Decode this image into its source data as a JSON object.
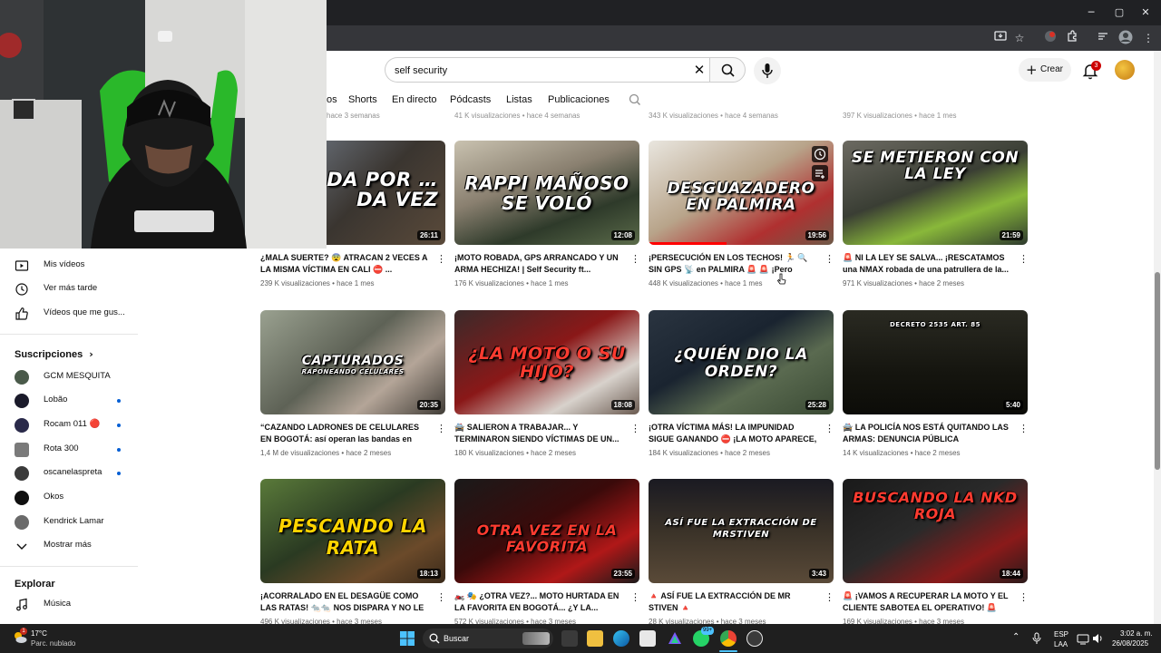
{
  "browser": {
    "window_controls": {
      "minimize": "─",
      "maximize": "▢",
      "close": "✕"
    }
  },
  "masthead": {
    "search_value": "self security",
    "create_label": "Crear",
    "notification_count": "3"
  },
  "chips": [
    "os",
    "Shorts",
    "En directo",
    "Pódcasts",
    "Listas",
    "Publicaciones"
  ],
  "sidebar": {
    "items": [
      {
        "label": "Mis vídeos",
        "icon": "play-square-icon"
      },
      {
        "label": "Ver más tarde",
        "icon": "clock-icon"
      },
      {
        "label": "Vídeos que me gus...",
        "icon": "thumbs-up-icon"
      }
    ],
    "subscriptions_heading": "Suscripciones",
    "subscriptions": [
      {
        "label": "GCM MESQUITA",
        "dot": false
      },
      {
        "label": "Lobão",
        "dot": true
      },
      {
        "label": "Rocam 011 🔴",
        "dot": true
      },
      {
        "label": "Rota 300",
        "dot": true
      },
      {
        "label": "oscanelaspreta",
        "dot": true
      },
      {
        "label": "Okos",
        "dot": false
      },
      {
        "label": "Kendrick Lamar",
        "dot": false
      }
    ],
    "show_more": "Mostrar más",
    "explore_heading": "Explorar",
    "explore_items": [
      {
        "label": "Música"
      }
    ]
  },
  "top_meta": [
    "hace 3 semanas",
    "41 K visualizaciones • hace 4 semanas",
    "343 K visualizaciones • hace 4 semanas",
    "397 K visualizaciones • hace 1 mes"
  ],
  "videos": [
    {
      "thumb_text": "…ADA POR …DA VEZ",
      "duration": "26:11",
      "title": "¿MALA SUERTE? 😨 ATRACAN 2 VECES A LA MISMA VÍCTIMA EN CALI ⛔ ...",
      "meta": "239 K visualizaciones • hace 1 mes"
    },
    {
      "thumb_text": "RAPPI MAÑOSO SE VOLÓ",
      "duration": "12:08",
      "title": "¡MOTO ROBADA, GPS ARRANCADO Y UN ARMA HECHIZA! | Self Security ft...",
      "meta": "176 K visualizaciones • hace 1 mes"
    },
    {
      "thumb_text": "DESGUAZADERO EN PALMIRA",
      "duration": "19:56",
      "title": "¡PERSECUCIÓN EN LOS TECHOS! 🏃 🔍 SIN GPS 📡 en PALMIRA 🚨 🚨 ¡Pero IGUAL la...",
      "meta": "448 K visualizaciones • hace 1 mes"
    },
    {
      "thumb_text": "SE METIERON CON LA LEY",
      "duration": "21:59",
      "title": "🚨 NI LA LEY SE SALVA... ¡RESCATAMOS una NMAX robada de una patrullera de la...",
      "meta": "971 K visualizaciones • hace 2 meses"
    },
    {
      "thumb_text": "CAPTURADOS",
      "thumb_sub": "RAPONEANDO CELULARES",
      "duration": "20:35",
      "title": "“CAZANDO LADRONES DE CELULARES EN BOGOTÁ: así operan las bandas en motos”",
      "meta": "1,4 M de visualizaciones • hace 2 meses"
    },
    {
      "thumb_text": "¿LA MOTO O SU HIJO?",
      "duration": "18:08",
      "title": "🚔 SALIERON A TRABAJAR... Y TERMINARON SIENDO VÍCTIMAS DE UN...",
      "meta": "180 K visualizaciones • hace 2 meses"
    },
    {
      "thumb_text": "¿QUIÉN DIO LA ORDEN?",
      "duration": "25:28",
      "title": "¡OTRA VÍCTIMA MÁS! LA IMPUNIDAD SIGUE GANANDO ⛔ ¡LA MOTO APARECE, PERO...",
      "meta": "184 K visualizaciones • hace 2 meses"
    },
    {
      "thumb_text": "DECRETO 2535 ART. 85",
      "duration": "5:40",
      "title": "🚔 LA POLICÍA NOS ESTÁ QUITANDO LAS ARMAS: DENUNCIA PÚBLICA",
      "meta": "14 K visualizaciones • hace 2 meses"
    },
    {
      "thumb_text": "PESCANDO LA RATA",
      "duration": "18:13",
      "title": "¡ACORRALADO EN EL DESAGÜE COMO LAS RATAS! 🐀🐀 NOS DISPARA Y NO LE VA...",
      "meta": "496 K visualizaciones • hace 3 meses"
    },
    {
      "thumb_text": "OTRA VEZ EN LA FAVORITA",
      "duration": "23:55",
      "title": "🏍️ 🎭 ¿OTRA VEZ?... MOTO HURTADA EN LA FAVORITA EN BOGOTÁ... ¿Y LA...",
      "meta": "572 K visualizaciones • hace 3 meses"
    },
    {
      "thumb_text": "ASÍ FUE LA EXTRACCIÓN DE MrStiven",
      "duration": "3:43",
      "title": "🔺 ASÍ FUE LA EXTRACCIÓN DE MR STIVEN 🔺",
      "meta": "28 K visualizaciones • hace 3 meses"
    },
    {
      "thumb_text": "BUSCANDO LA NKD ROJA",
      "duration": "18:44",
      "title": "🚨 ¡VAMOS A RECUPERAR LA MOTO Y EL CLIENTE SABOTEA EL OPERATIVO! 🚨",
      "meta": "169 K visualizaciones • hace 3 meses"
    }
  ],
  "taskbar": {
    "weather_temp": "17°C",
    "weather_desc": "Parc. nublado",
    "search_placeholder": "Buscar",
    "lang": "ESP",
    "lang_sub": "LAA",
    "time": "3:02 a. m.",
    "date": "26/08/2025",
    "whatsapp_badge": "99+"
  }
}
